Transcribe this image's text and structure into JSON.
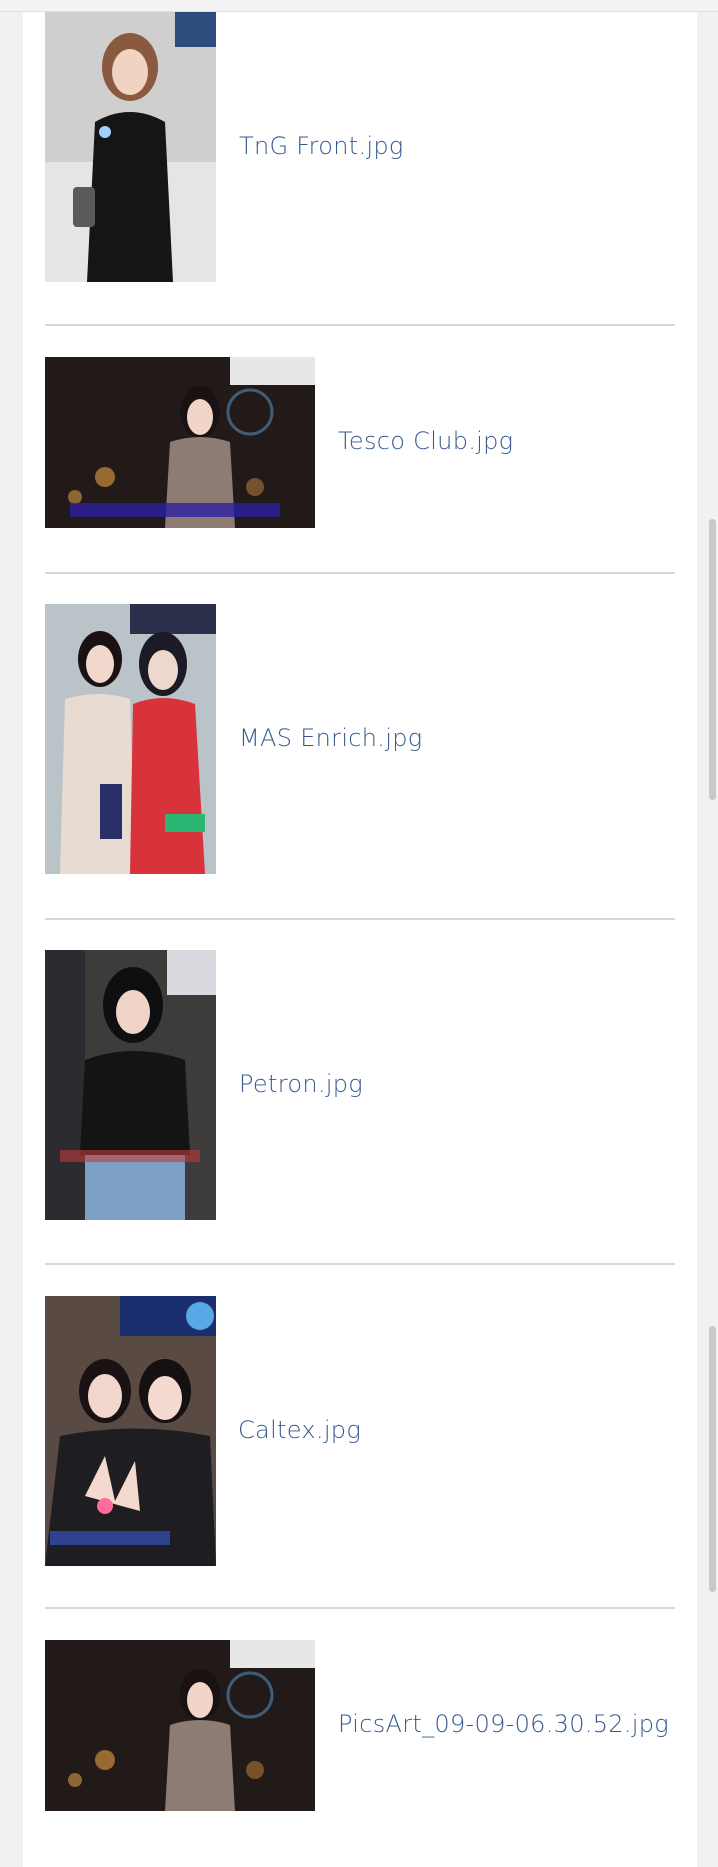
{
  "files": [
    {
      "name": "TnG Front.jpg"
    },
    {
      "name": "Tesco Club.jpg"
    },
    {
      "name": "MAS Enrich.jpg"
    },
    {
      "name": "Petron.jpg"
    },
    {
      "name": "Caltex.jpg"
    },
    {
      "name": "PicsArt_09-09-06.30.52.jpg"
    }
  ],
  "colors": {
    "link": "#36598f",
    "divider": "#d8d8d8",
    "background": "#f1f1f1",
    "page": "#ffffff"
  }
}
